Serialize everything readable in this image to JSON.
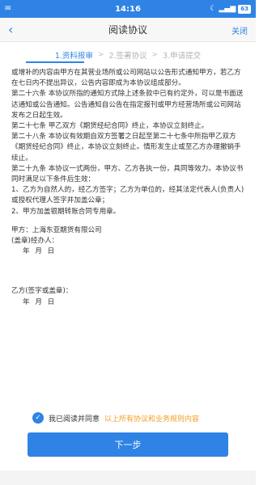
{
  "status_bar": {
    "time": "14:16",
    "battery": "63"
  },
  "nav": {
    "back_icon": "chevron-left-icon",
    "title": "阅读协议",
    "close_label": "关闭"
  },
  "steps": [
    {
      "label": "1.资料报审",
      "active": true
    },
    {
      "label": "2.签署协议",
      "active": false
    },
    {
      "label": "3.申请提交",
      "active": false
    }
  ],
  "step_arrow": ">",
  "content": {
    "paragraphs": [
      "或增补的内容由甲方在其营业场所或公司网站以公告形式通知甲方，若乙方在七日内不提出异议，公告内容即成为本协议组成部分。",
      "第二十六条 本协议所指的通知方式除上述条款中已有约定外，可以是书面送达通知或公告通知。公告通知自公告在指定报刊或甲方经营场所或公司网站发布之日起生效。",
      "第二十七条 甲乙双方《期货经纪合同》终止，本协议立刻终止。",
      "第二十八条 本协议有效期自双方签署之日起至第二十七条中所指甲乙双方《期货经纪合同》终止，本协议立刻终止。情形发生止或至乙方办理撤销手续止。",
      "第二十九条 本协议一式两份，甲方、乙方各执一份，具同等效力。本协议书同时满足以下条件后生效：",
      "1、乙方为自然人的，经乙方签字；乙方为单位的，经其法定代表人(负责人)或授权代理人签字并加盖公章；",
      "2、甲方加盖银期转账合同专用章。"
    ],
    "party_a": "甲方：上海东亚期货有限公司",
    "party_a_sign": "(盖章)经办人：",
    "date_a": "年 月 日",
    "party_b": "乙方(签字或盖章)：",
    "date_b": "年 月 日"
  },
  "agreement": {
    "checked": true,
    "text": "我已阅读并同意",
    "link": "以上所有协议和业务规则内容"
  },
  "next_button": "下一步"
}
